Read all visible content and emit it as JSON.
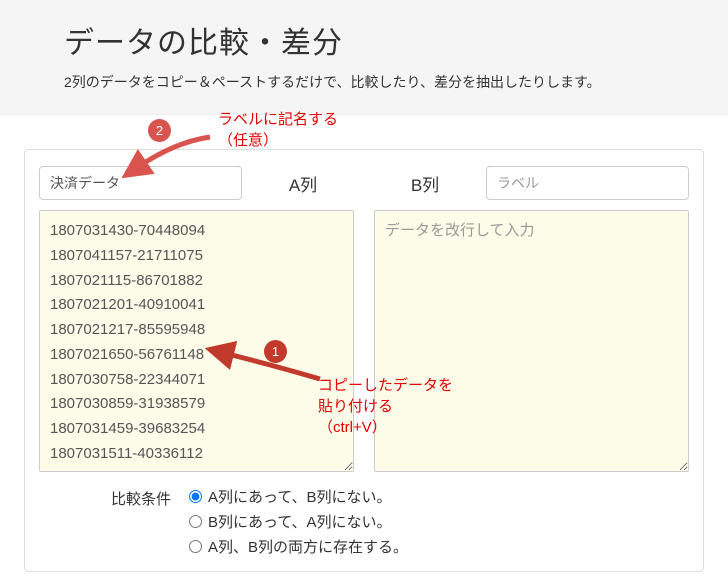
{
  "header": {
    "title": "データの比較・差分",
    "subtitle": "2列のデータをコピー＆ペーストするだけで、比較したり、差分を抽出したりします。"
  },
  "columnA": {
    "label_input": "決済データ",
    "heading": "A列",
    "data": "1807031430-70448094\n1807041157-21711075\n1807021115-86701882\n1807021201-40910041\n1807021217-85595948\n1807021650-56761148\n1807030758-22344071\n1807030859-31938579\n1807031459-39683254\n1807031511-40336112"
  },
  "columnB": {
    "heading": "B列",
    "label_placeholder": "ラベル",
    "data_placeholder": "データを改行して入力"
  },
  "compare": {
    "label": "比較条件",
    "opt1": "A列にあって、B列にない。",
    "opt2": "B列にあって、A列にない。",
    "opt3": "A列、B列の両方に存在する。"
  },
  "anno": {
    "label_hint_l1": "ラベルに記名する",
    "label_hint_l2": "（任意）",
    "paste_hint_l1": "コピーしたデータを",
    "paste_hint_l2": "貼り付ける",
    "paste_hint_l3": "（ctrl+V）",
    "badge1": "1",
    "badge2": "2"
  }
}
